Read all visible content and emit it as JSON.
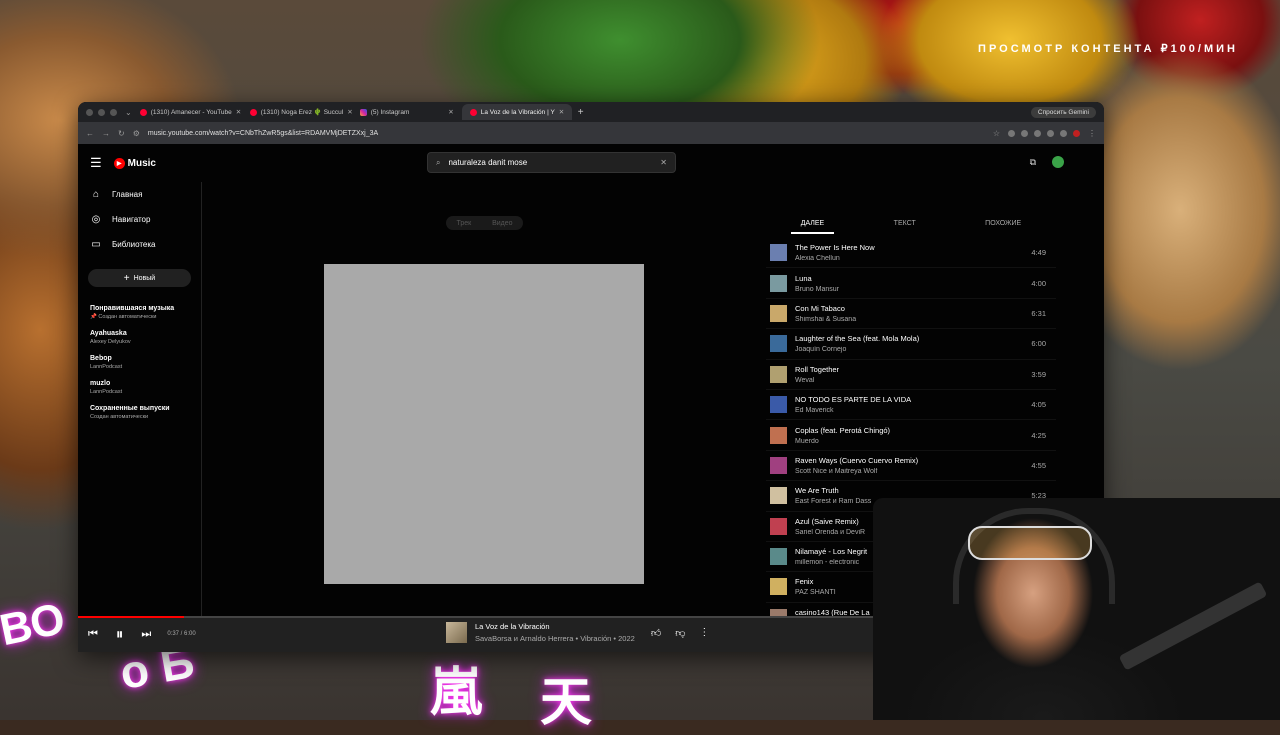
{
  "overlay": {
    "top_text": "ПРОСМОТР КОНТЕНТА ₽100/МИН"
  },
  "browser": {
    "tabs": [
      {
        "label": "(1310) Amanecer - YouTube",
        "active": false
      },
      {
        "label": "(1310) Noga Erez 🌵 Succul",
        "active": false
      },
      {
        "label": "(5) Instagram",
        "active": false
      },
      {
        "label": "La Voz de la Vibración | Y",
        "active": true
      }
    ],
    "gemini_label": "Спросить Gemini",
    "url": "music.youtube.com/watch?v=CNbThZwR5gs&list=RDAMVMjDETZXxj_3A"
  },
  "header": {
    "logo_text": "Music",
    "search_value": "naturaleza danit mose"
  },
  "sidebar": {
    "nav": [
      {
        "label": "Главная",
        "icon": "home-icon"
      },
      {
        "label": "Навигатор",
        "icon": "compass-icon"
      },
      {
        "label": "Библиотека",
        "icon": "library-icon"
      }
    ],
    "new_label": "Новый",
    "playlists": [
      {
        "title": "Понравившаяся музыка",
        "sub": "📌 Создан автоматически"
      },
      {
        "title": "Ayahuaska",
        "sub": "Alexey Delyukov"
      },
      {
        "title": "Bebop",
        "sub": "LannPodcast"
      },
      {
        "title": "muzlo",
        "sub": "LannPodcast"
      },
      {
        "title": "Сохраненные выпуски",
        "sub": "Создан автоматически"
      }
    ]
  },
  "main": {
    "toggle": [
      "Трек",
      "Видео"
    ],
    "tabs": [
      "ДАЛЕЕ",
      "ТЕКСТ",
      "ПОХОЖИЕ"
    ],
    "queue": [
      {
        "title": "The Power Is Here Now",
        "artist": "Alexia Chellun",
        "duration": "4:49",
        "color": "#6b7fb0"
      },
      {
        "title": "Luna",
        "artist": "Bruno Mansur",
        "duration": "4:00",
        "color": "#7a9aa0"
      },
      {
        "title": "Con Mi Tabaco",
        "artist": "Shimshai & Susana",
        "duration": "6:31",
        "color": "#c9a86a"
      },
      {
        "title": "Laughter of the Sea (feat. Mola Mola)",
        "artist": "Joaquín Cornejo",
        "duration": "6:00",
        "color": "#3a6a9a"
      },
      {
        "title": "Roll Together",
        "artist": "Weval",
        "duration": "3:59",
        "color": "#b0a070"
      },
      {
        "title": "NO TODO ES PARTE DE LA VIDA",
        "artist": "Ed Maverick",
        "duration": "4:05",
        "color": "#3a5aa8"
      },
      {
        "title": "Coplas (feat. Perotá Chingó)",
        "artist": "Muerdo",
        "duration": "4:25",
        "color": "#c07050"
      },
      {
        "title": "Raven Ways (Cuervo Cuervo Remix)",
        "artist": "Scott Nice и Maitreya Wolf",
        "duration": "4:55",
        "color": "#a04080"
      },
      {
        "title": "We Are Truth",
        "artist": "East Forest и Ram Dass",
        "duration": "5:23",
        "color": "#d0c0a0"
      },
      {
        "title": "Azul (Saive Remix)",
        "artist": "Sariel Orenda и DeviR",
        "duration": "",
        "color": "#c04050"
      },
      {
        "title": "Nilamayé - Los Negrit",
        "artist": "millemon - electronic",
        "duration": "",
        "color": "#5a8a8a"
      },
      {
        "title": "Fenix",
        "artist": "PAZ SHANTI",
        "duration": "",
        "color": "#d0b060"
      },
      {
        "title": "casino143 (Rue De La",
        "artist": "IVOXYGEN, LATIN MA",
        "duration": "",
        "color": "#9a7a6a"
      }
    ]
  },
  "player": {
    "time": "0:37 / 6:00",
    "progress": 0.103,
    "title": "La Voz de la Vibración",
    "subtitle": "SavaBorsa и Arnaldo Herrera • Vibración • 2022"
  }
}
